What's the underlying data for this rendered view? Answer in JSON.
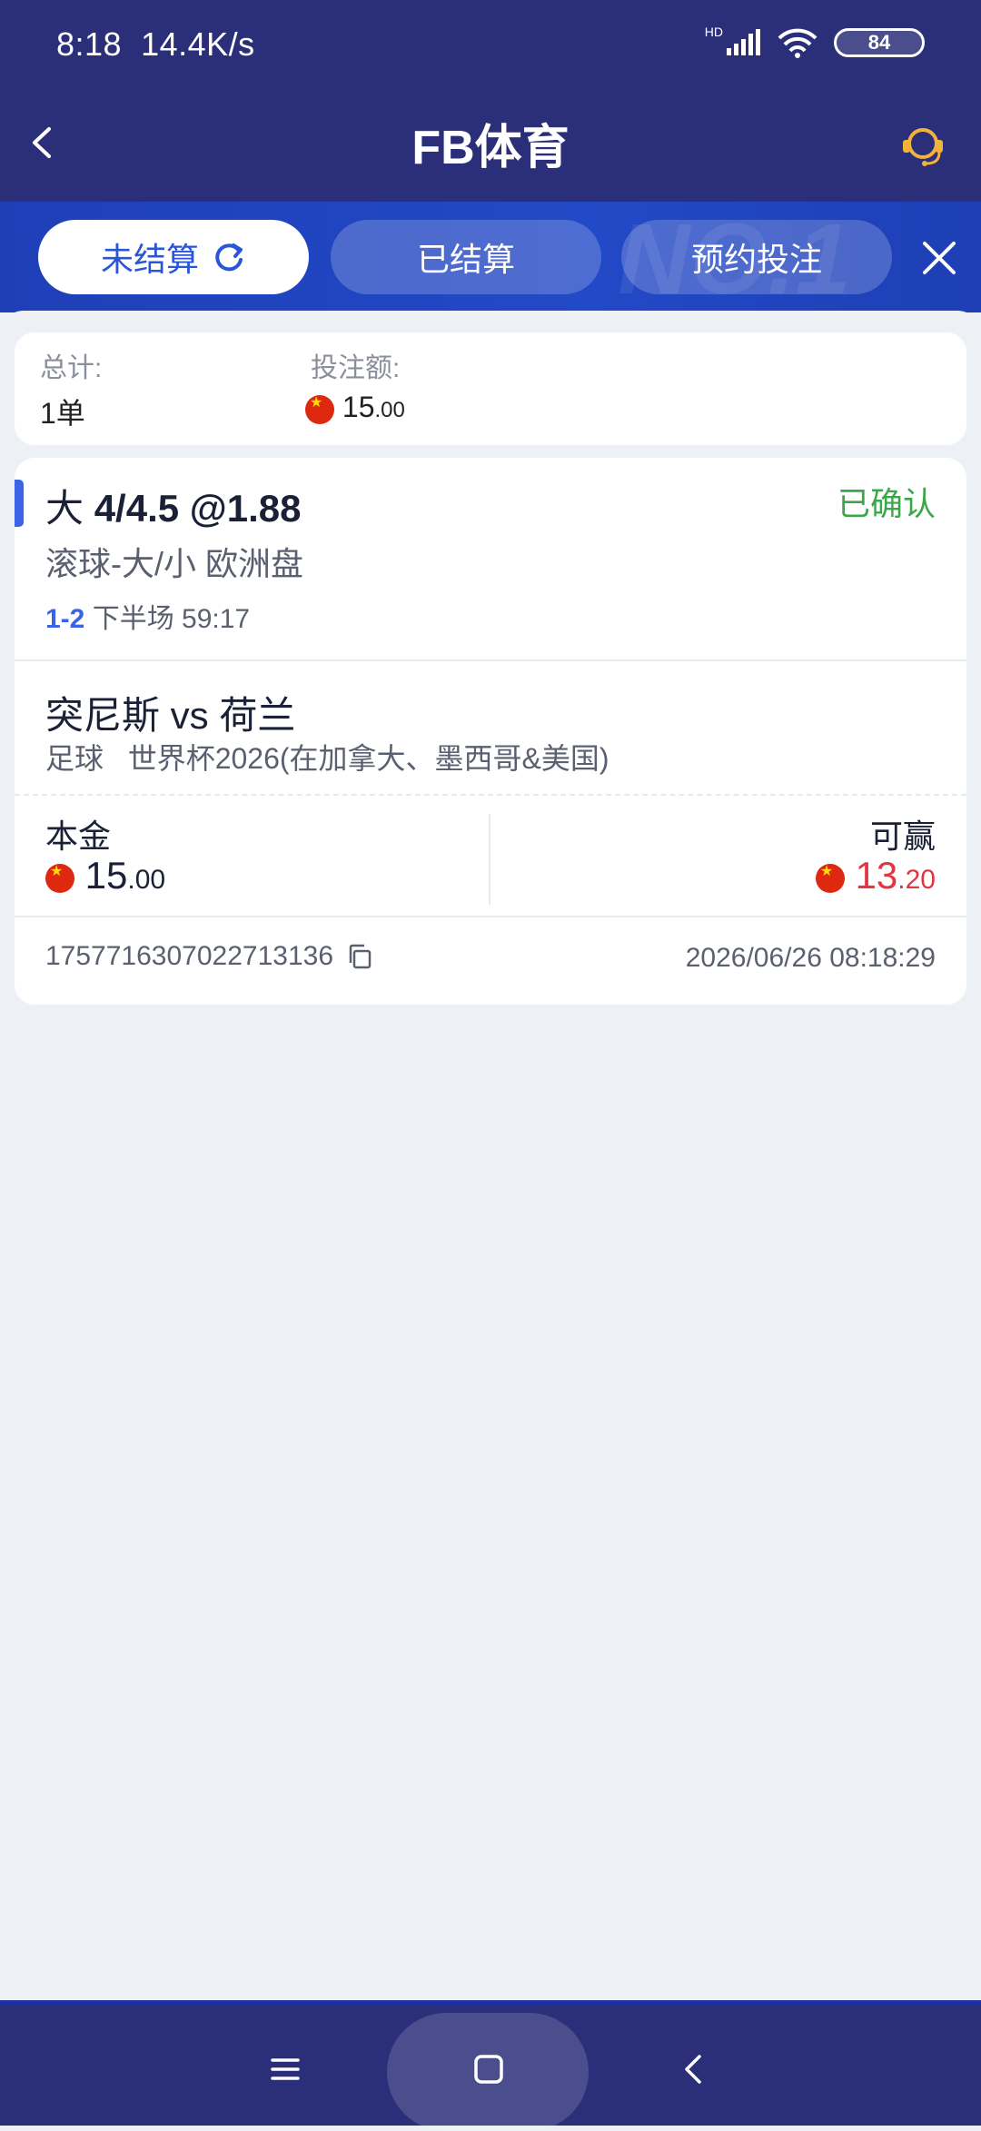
{
  "status_bar": {
    "time": "8:18",
    "net_speed": "14.4K/s",
    "signal_label": "HD",
    "battery": "84"
  },
  "header": {
    "title": "FB体育"
  },
  "tabs": [
    {
      "label": "未结算",
      "active": true
    },
    {
      "label": "已结算",
      "active": false
    },
    {
      "label": "预约投注",
      "active": false
    }
  ],
  "summary": {
    "total_label": "总计:",
    "total_value": "1单",
    "stake_label": "投注额:",
    "stake_int": "15",
    "stake_dec": ".00"
  },
  "bet": {
    "selection_prefix": "大",
    "selection_main": "4/4.5 @1.88",
    "status": "已确认",
    "market": "滚球-大/小 欧洲盘",
    "score": "1-2",
    "period": "下半场 59:17",
    "match": "突尼斯 vs 荷兰",
    "sport": "足球",
    "league": "世界杯2026(在加拿大、墨西哥&美国)",
    "principal_label": "本金",
    "principal_int": "15",
    "principal_dec": ".00",
    "win_label": "可赢",
    "win_int": "13",
    "win_dec": ".20",
    "order_id": "1757716307022713136",
    "datetime": "2026/06/26 08:18:29"
  },
  "colors": {
    "accent": "#3a63e6",
    "header_bg": "#2b2f7a",
    "confirmed": "#3aa84a",
    "win": "#e3343f"
  }
}
